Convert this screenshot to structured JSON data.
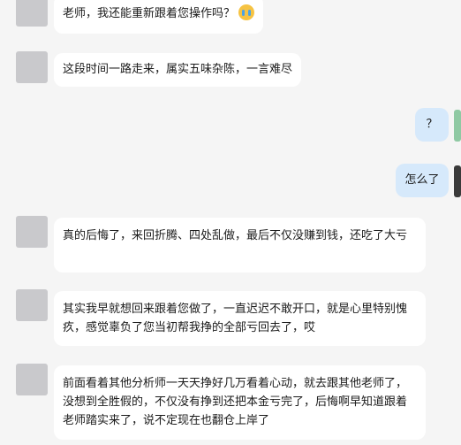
{
  "chat": {
    "messages": [
      {
        "side": "left",
        "text": "老师，我还能重新跟着您操作吗？",
        "emoji": "crying-face-icon"
      },
      {
        "side": "left",
        "text": "这段时间一路走来，属实五味杂陈，一言难尽"
      },
      {
        "side": "right",
        "text": "？",
        "avatar_color": "#8fc9a3"
      },
      {
        "side": "right",
        "text": "怎么了",
        "avatar_color": "#3a3a3a"
      },
      {
        "side": "left",
        "text": "真的后悔了，来回折腾、四处乱做，最后不仅没赚到钱，还吃了大亏"
      },
      {
        "side": "left",
        "text": "其实我早就想回来跟着您做了，一直迟迟不敢开口，就是心里特别愧疚，感觉辜负了您当初帮我挣的全部亏回去了，哎"
      },
      {
        "side": "left",
        "text": "前面看着其他分析师一天天挣好几万看着心动，就去跟其他老师了，没想到全胜假的，不仅没有挣到还把本金亏完了，后悔啊早知道跟着老师踏实来了，说不定现在也翻仓上岸了"
      }
    ]
  }
}
